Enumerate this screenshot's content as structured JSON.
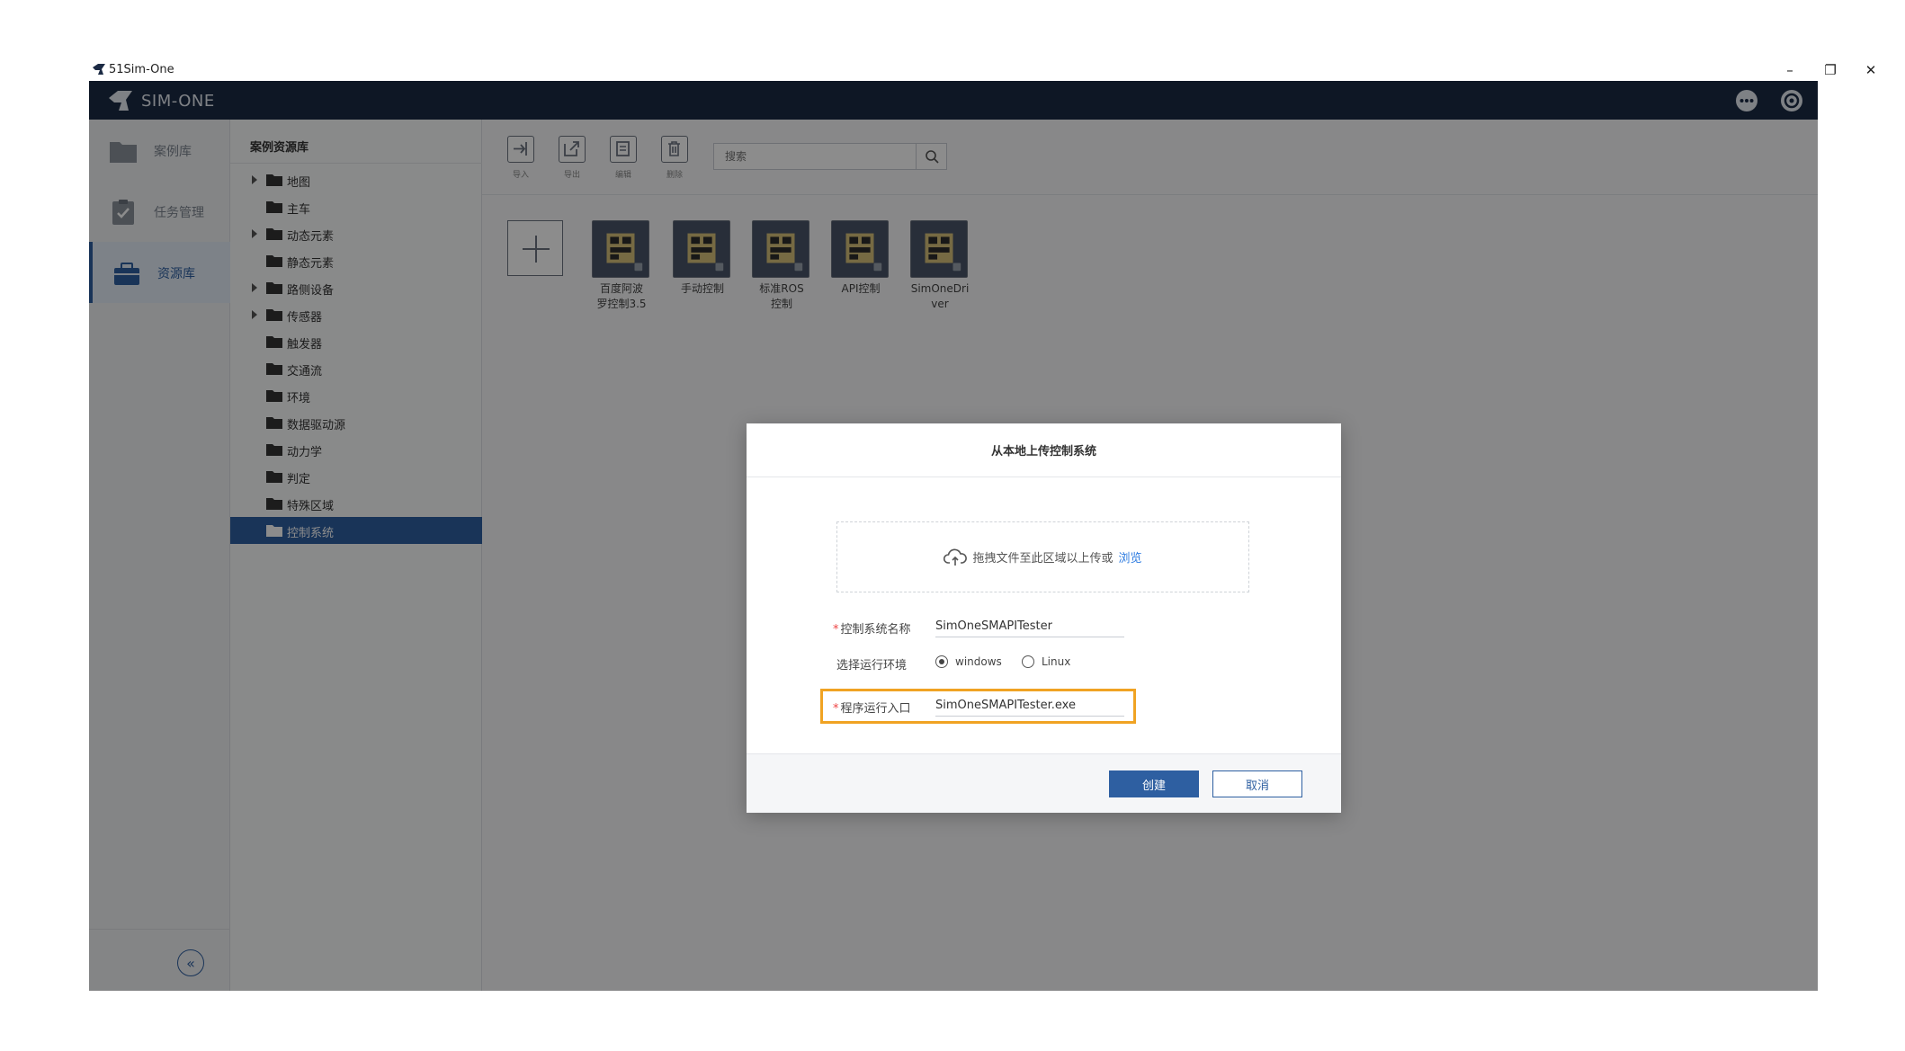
{
  "window": {
    "title": "51Sim-One",
    "minimize": "–",
    "restore": "❐",
    "close": "✕"
  },
  "topbar": {
    "brand": "SIM-ONE",
    "icons": [
      "more-icon",
      "settings-icon"
    ]
  },
  "sidebar": {
    "items": [
      {
        "label": "案例库",
        "icon": "folder-icon",
        "active": false
      },
      {
        "label": "任务管理",
        "icon": "clipboard-check-icon",
        "active": false
      },
      {
        "label": "资源库",
        "icon": "toolbox-icon",
        "active": true
      }
    ],
    "collapse_label": "«"
  },
  "tree": {
    "header": "案例资源库",
    "items": [
      {
        "label": "地图",
        "expandable": true
      },
      {
        "label": "主车",
        "expandable": false
      },
      {
        "label": "动态元素",
        "expandable": true
      },
      {
        "label": "静态元素",
        "expandable": false
      },
      {
        "label": "路侧设备",
        "expandable": true
      },
      {
        "label": "传感器",
        "expandable": true
      },
      {
        "label": "触发器",
        "expandable": false
      },
      {
        "label": "交通流",
        "expandable": false
      },
      {
        "label": "环境",
        "expandable": false
      },
      {
        "label": "数据驱动源",
        "expandable": false
      },
      {
        "label": "动力学",
        "expandable": false
      },
      {
        "label": "判定",
        "expandable": false
      },
      {
        "label": "特殊区域",
        "expandable": false
      },
      {
        "label": "控制系统",
        "expandable": false,
        "selected": true
      }
    ]
  },
  "toolbar": {
    "import_label": "导入",
    "export_label": "导出",
    "edit_label": "编辑",
    "delete_label": "删除",
    "search_placeholder": "搜索"
  },
  "cards": [
    {
      "line1": "百度阿波",
      "line2": "罗控制3.5"
    },
    {
      "line1": "手动控制",
      "line2": ""
    },
    {
      "line1": "标准ROS",
      "line2": "控制"
    },
    {
      "line1": "API控制",
      "line2": ""
    },
    {
      "line1": "SimOneDri",
      "line2": "ver"
    }
  ],
  "dialog": {
    "title": "从本地上传控制系统",
    "dropzone_text": "拖拽文件至此区域以上传或",
    "browse_label": "浏览",
    "name_label": "控制系统名称",
    "name_value": "SimOneSMAPITester",
    "env_label": "选择运行环境",
    "env_options": [
      "windows",
      "Linux"
    ],
    "env_selected": "windows",
    "entry_label": "程序运行入口",
    "entry_value": "SimOneSMAPITester.exe",
    "required_mark": "*",
    "create_label": "创建",
    "cancel_label": "取消",
    "highlight_color": "#f0a323"
  },
  "colors": {
    "topbar": "#1b2a44",
    "accent": "#2e5fa1",
    "link": "#2d7be0"
  }
}
